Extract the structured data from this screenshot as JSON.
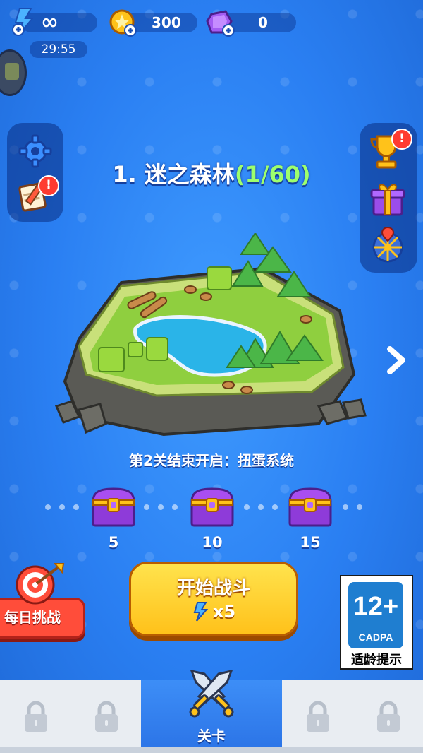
{
  "top_bar": {
    "energy_value": "∞",
    "coins_value": "300",
    "gems_value": "0",
    "timer": "29:55"
  },
  "level": {
    "title": "1. 迷之森林",
    "progress": "(1/60)"
  },
  "unlock_text": "第2关结束开启：扭蛋系统",
  "chests": [
    {
      "label": "5"
    },
    {
      "label": "10"
    },
    {
      "label": "15"
    }
  ],
  "start_button": {
    "label": "开始战斗",
    "cost": "x5"
  },
  "daily_challenge": {
    "label": "每日挑战"
  },
  "age_rating": {
    "number": "12+",
    "brand": "CADPA",
    "tip": "适龄提示"
  },
  "bottom_nav": {
    "selected_label": "关卡"
  },
  "badges": {
    "tasks_badge": "!",
    "trophy_badge": "!"
  },
  "colors": {
    "background": "#2a7ff2",
    "progress_green": "#9dff6d",
    "start_button": "#ffc11a",
    "daily_red": "#ff4d3a",
    "badge_red": "#ff3b30"
  }
}
